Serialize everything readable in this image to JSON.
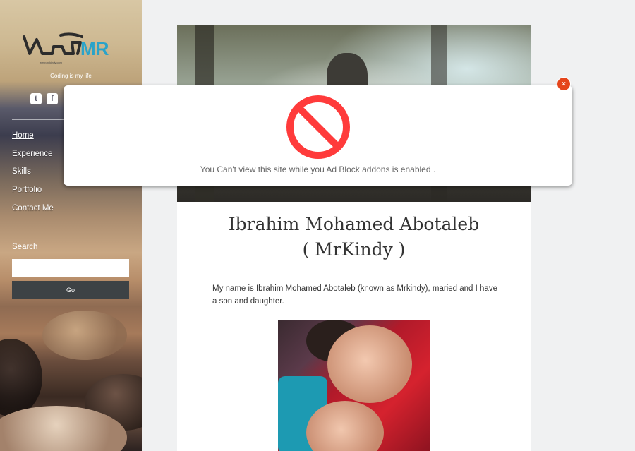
{
  "sidebar": {
    "logo_text": "MR",
    "logo_url": "www.mrkindy.com",
    "tagline": "Coding is my life",
    "social": [
      {
        "icon": "twitter-icon",
        "glyph": "t"
      },
      {
        "icon": "facebook-icon",
        "glyph": "f"
      }
    ],
    "nav": [
      {
        "label": "Home",
        "active": true
      },
      {
        "label": "Experience",
        "active": false
      },
      {
        "label": "Skills",
        "active": false
      },
      {
        "label": "Portfolio",
        "active": false
      },
      {
        "label": "Contact Me",
        "active": false
      }
    ],
    "search_label": "Search",
    "search_placeholder": "",
    "go_label": "Go"
  },
  "article": {
    "title_line1": "Ibrahim Mohamed Abotaleb",
    "title_line2": "( MrKindy )",
    "bio": "My name is Ibrahim Mohamed Abotaleb (known as Mrkindy), maried and I have a son and daughter."
  },
  "modal": {
    "icon": "no-entry-icon",
    "message": "You Can't view this site while you Ad Block addons is enabled .",
    "close_label": "×",
    "accent_color": "#ff3b3b",
    "close_color": "#e5451b"
  }
}
